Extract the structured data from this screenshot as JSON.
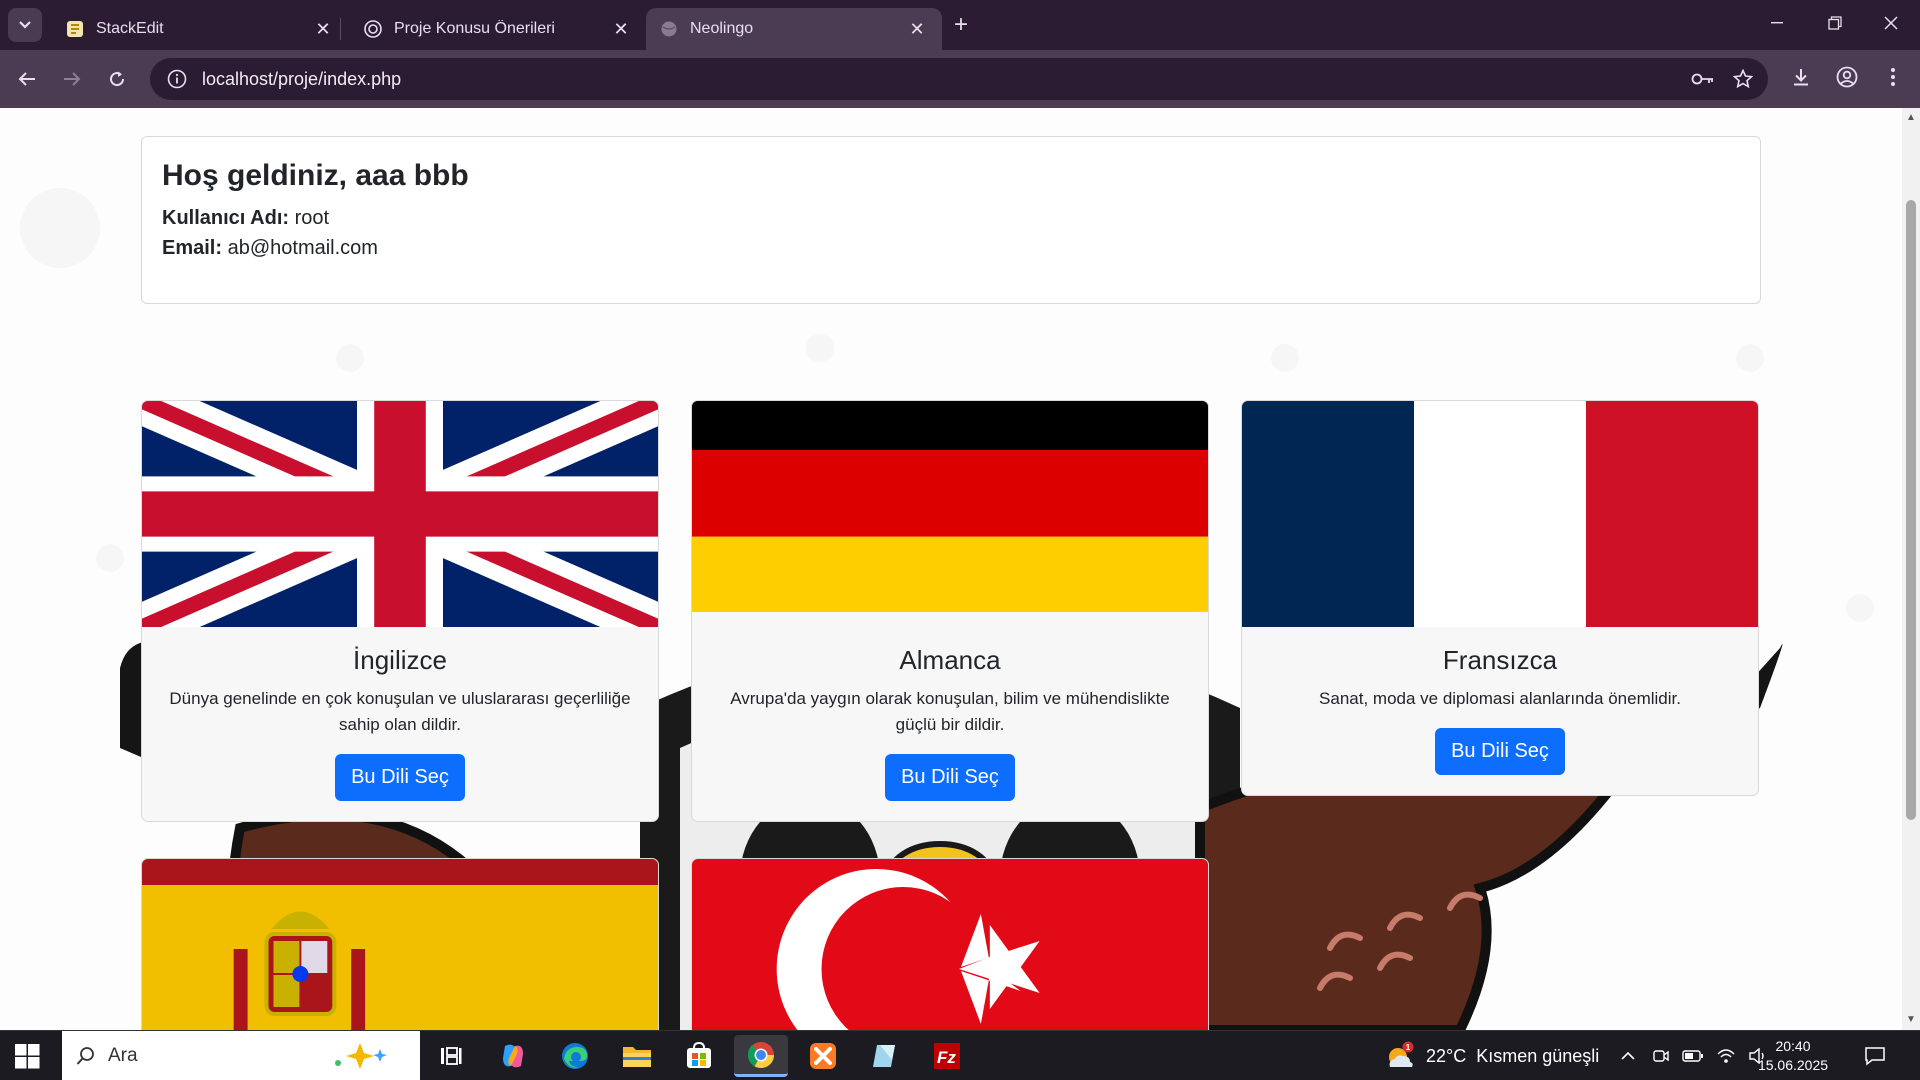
{
  "browser": {
    "tabs": [
      {
        "title": "StackEdit",
        "active": false
      },
      {
        "title": "Proje Konusu Önerileri",
        "active": false
      },
      {
        "title": "Neolingo",
        "active": true
      }
    ],
    "url": "localhost/proje/index.php"
  },
  "profile": {
    "greeting": "Hoş geldiniz, aaa bbb",
    "username_label": "Kullanıcı Adı:",
    "username": "root",
    "email_label": "Email:",
    "email": "ab@hotmail.com"
  },
  "languages": [
    {
      "name": "İngilizce",
      "desc": "Dünya genelinde en çok konuşulan ve uluslararası geçerliliğe sahip olan dildir.",
      "button": "Bu Dili Seç",
      "flag": "uk-flag"
    },
    {
      "name": "Almanca",
      "desc": "Avrupa'da yaygın olarak konuşulan, bilim ve mühendislikte güçlü bir dildir.",
      "button": "Bu Dili Seç",
      "flag": "germany-flag"
    },
    {
      "name": "Fransızca",
      "desc": "Sanat, moda ve diplomasi alanlarında önemlidir.",
      "button": "Bu Dili Seç",
      "flag": "france-flag"
    },
    {
      "flag": "spain-flag"
    },
    {
      "flag": "turkey-flag"
    }
  ],
  "taskbar": {
    "search_placeholder": "Ara",
    "weather_temp": "22°C",
    "weather_text": "Kısmen güneşli",
    "weather_badge": "1",
    "time": "20:40",
    "date": "15.06.2025"
  },
  "colors": {
    "accent": "#0d6efd",
    "chrome_dark": "#2b1b33",
    "chrome_mid": "#4b3b53"
  }
}
